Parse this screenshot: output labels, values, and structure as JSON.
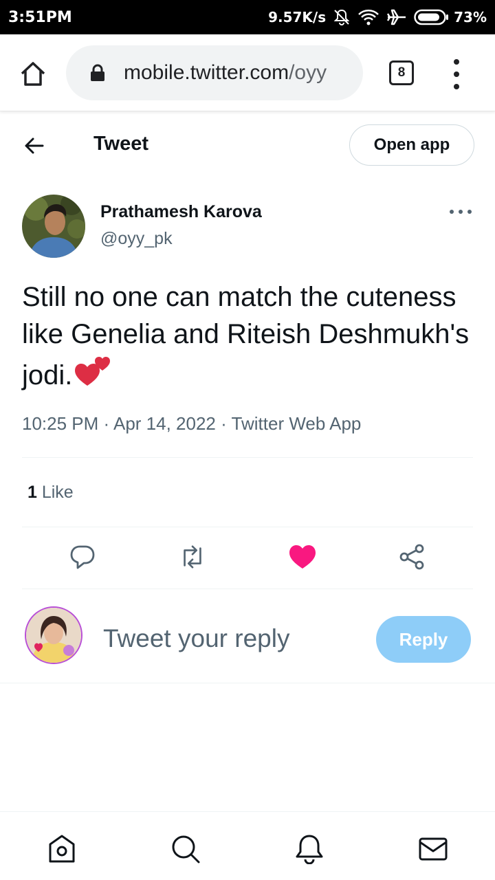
{
  "status_bar": {
    "time": "3:51PM",
    "net_speed": "9.57K/s",
    "battery": "73%",
    "icons": [
      "mute-icon",
      "wifi-icon",
      "airplane-icon",
      "battery-icon"
    ]
  },
  "browser": {
    "url_domain": "mobile.twitter.com",
    "url_path": "/oyy",
    "tab_count": "8"
  },
  "header": {
    "title": "Tweet",
    "open_app_label": "Open app"
  },
  "tweet": {
    "author_name": "Prathamesh Karova",
    "author_handle": "@oyy_pk",
    "text": "Still no one can match the cuteness like Genelia and Riteish Deshmukh's jodi.",
    "time": "10:25 PM",
    "date": "Apr 14, 2022",
    "source": "Twitter Web App",
    "likes_count": "1",
    "likes_label": " Like",
    "liked": true
  },
  "reply": {
    "placeholder": "Tweet your reply",
    "button_label": "Reply"
  },
  "colors": {
    "twitter_blue_disabled": "#8ecdf8",
    "like_pink": "#f91880",
    "secondary_text": "#536471"
  },
  "bottom_nav": [
    "home-icon",
    "search-icon",
    "notifications-icon",
    "messages-icon"
  ]
}
